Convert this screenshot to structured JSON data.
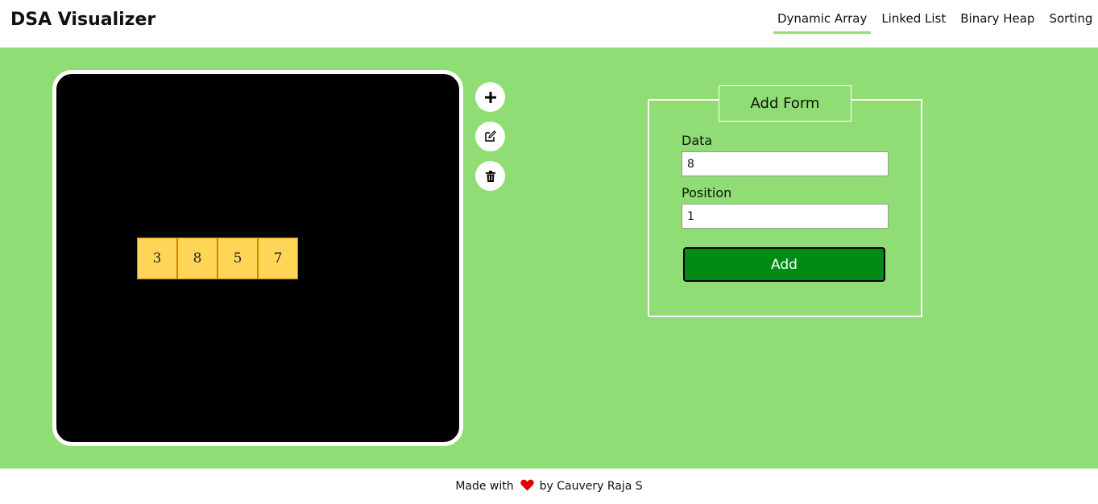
{
  "header": {
    "brand": "DSA Visualizer",
    "nav": [
      {
        "label": "Dynamic Array",
        "active": true
      },
      {
        "label": "Linked List",
        "active": false
      },
      {
        "label": "Binary Heap",
        "active": false
      },
      {
        "label": "Sorting",
        "active": false
      }
    ]
  },
  "visualizer": {
    "cells": [
      "3",
      "8",
      "5",
      "7"
    ]
  },
  "tools": [
    {
      "name": "plus-icon"
    },
    {
      "name": "edit-icon"
    },
    {
      "name": "trash-icon"
    }
  ],
  "form": {
    "title": "Add Form",
    "data_label": "Data",
    "data_value": "8",
    "position_label": "Position",
    "position_value": "1",
    "submit_label": "Add"
  },
  "footer": {
    "prefix": "Made with",
    "suffix": "by Cauvery Raja S",
    "icon": "heart-icon"
  },
  "colors": {
    "accent": "#8fdd74",
    "cell": "#ffd558",
    "button": "#008c14",
    "heart": "#e00000"
  }
}
